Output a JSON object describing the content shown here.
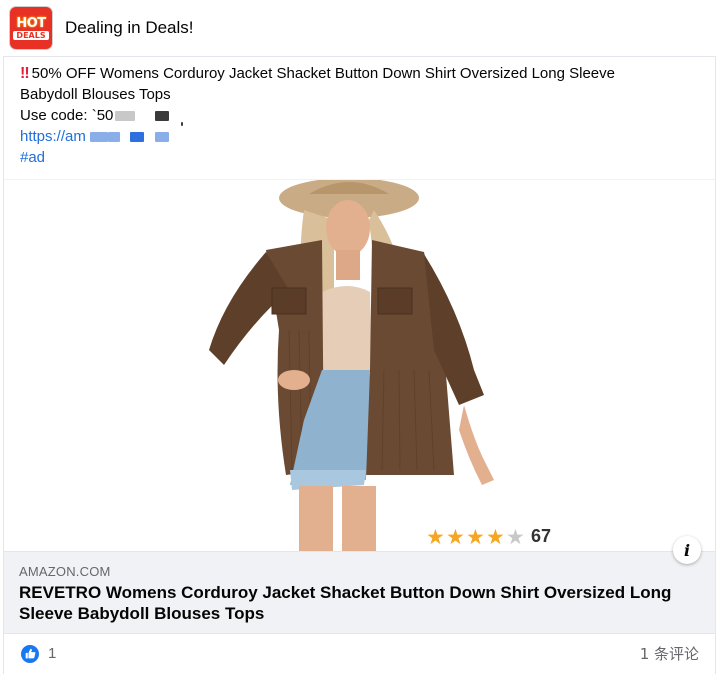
{
  "page": {
    "name": "Dealing in Deals!"
  },
  "logo": {
    "hot": "HOT",
    "deals": "DEALS"
  },
  "post": {
    "bang": "‼",
    "line1": "50% OFF  Womens Corduroy Jacket Shacket Button Down Shirt Oversized Long Sleeve",
    "line2": "Babydoll Blouses Tops",
    "code_label": "Use code: `50",
    "link_prefix": "https://am",
    "hashtag": "#ad"
  },
  "product_image": {
    "rating_stars": 4.5,
    "review_count": "67",
    "colors": {
      "jacket": "#6b4a33",
      "shorts": "#8fb3cf",
      "hat": "#c9ab86",
      "star": "#f5a623"
    }
  },
  "link_preview": {
    "domain": "AMAZON.COM",
    "title": "REVETRO Womens Corduroy Jacket Shacket Button Down Shirt Oversized Long Sleeve Babydoll Blouses Tops",
    "info_icon": "i"
  },
  "footer": {
    "like_count": "1",
    "comments": "1 条评论"
  },
  "colors": {
    "link": "#216fdb",
    "like": "#1877f2",
    "secondary": "#65676b"
  }
}
